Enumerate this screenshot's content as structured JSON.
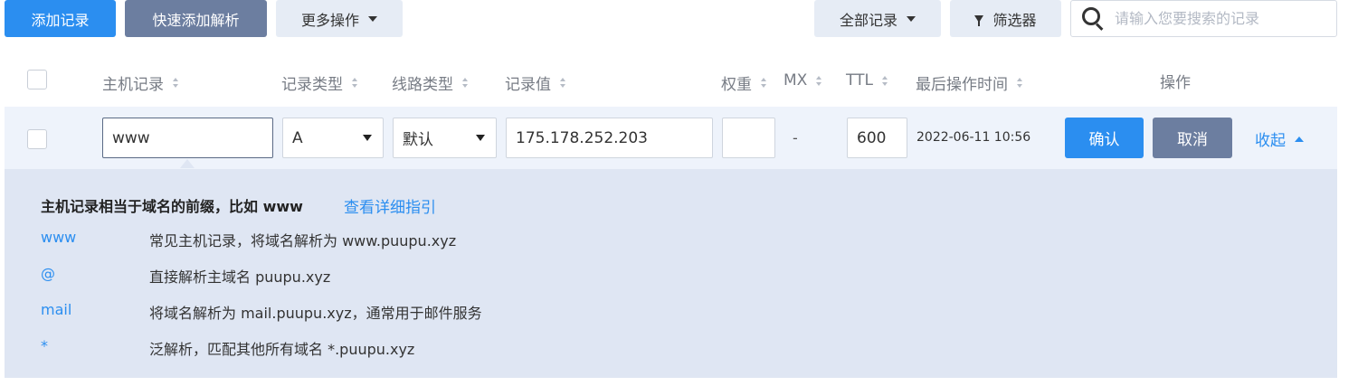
{
  "toolbar": {
    "add_record": "添加记录",
    "quick_add": "快速添加解析",
    "more_actions": "更多操作",
    "all_records": "全部记录",
    "filter": "筛选器",
    "search_placeholder": "请输入您要搜索的记录"
  },
  "columns": {
    "host": "主机记录",
    "type": "记录类型",
    "line": "线路类型",
    "value": "记录值",
    "weight": "权重",
    "mx": "MX",
    "ttl": "TTL",
    "last_op": "最后操作时间",
    "actions": "操作"
  },
  "edit_row": {
    "host": "www",
    "type": "A",
    "line": "默认",
    "value": "175.178.252.203",
    "weight": "",
    "mx": "-",
    "ttl": "600",
    "last_op": "2022-06-11 10:56",
    "confirm": "确认",
    "cancel": "取消",
    "collapse": "收起"
  },
  "help": {
    "title": "主机记录相当于域名的前缀，比如 www",
    "guide_link": "查看详细指引",
    "items": [
      {
        "key": "www",
        "desc": "常见主机记录，将域名解析为 www.puupu.xyz"
      },
      {
        "key": "@",
        "desc": "直接解析主域名 puupu.xyz"
      },
      {
        "key": "mail",
        "desc": "将域名解析为 mail.puupu.xyz，通常用于邮件服务"
      },
      {
        "key": "*",
        "desc": "泛解析，匹配其他所有域名 *.puupu.xyz"
      }
    ]
  },
  "colors": {
    "primary": "#2b8ef0",
    "slate_button": "#6c7ea0",
    "light_button": "#e6ecf5",
    "edit_row_bg": "#eef3fb",
    "help_bg": "#dfe6f3"
  }
}
